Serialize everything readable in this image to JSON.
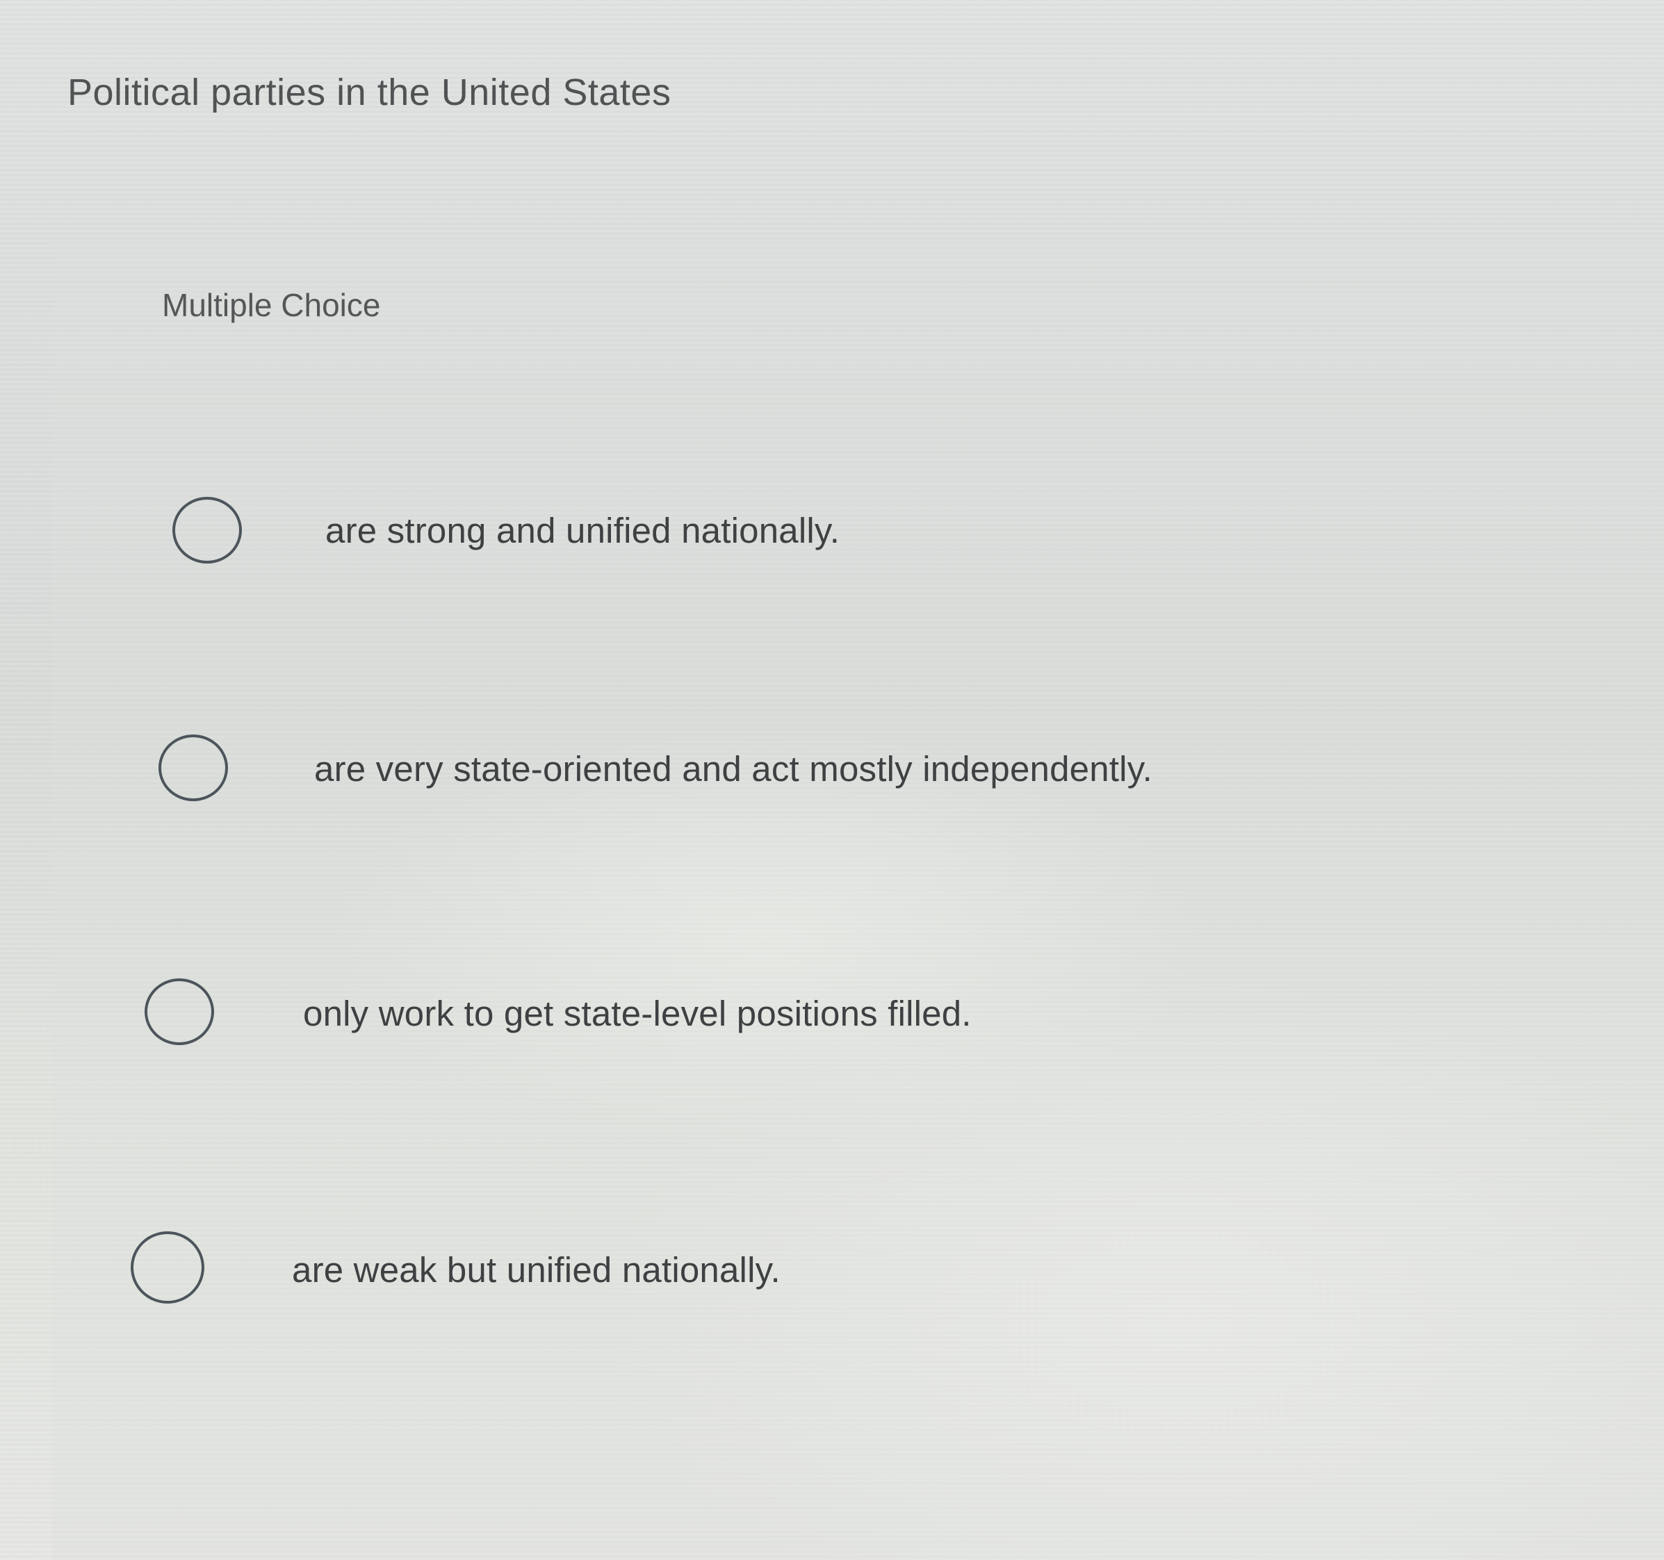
{
  "question": {
    "prompt": "Political parties in the United States",
    "type_label": "Multiple Choice"
  },
  "choices": [
    {
      "label": "are strong and unified nationally.",
      "selected": false
    },
    {
      "label": "are very state-oriented and act mostly independently.",
      "selected": false
    },
    {
      "label": "only work to get state-level positions filled.",
      "selected": false
    },
    {
      "label": "are weak but unified nationally.",
      "selected": false
    }
  ]
}
